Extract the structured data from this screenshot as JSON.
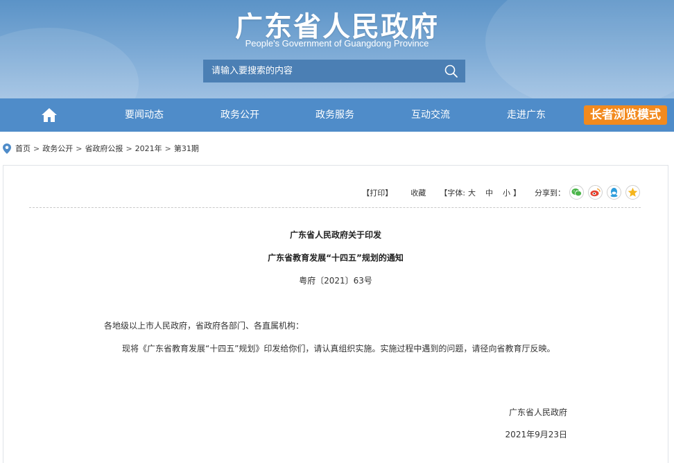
{
  "header": {
    "title": "广东省人民政府",
    "subtitle": "People's Government of Guangdong Province",
    "search_placeholder": "请输入要搜索的内容",
    "search_icon": "search-icon"
  },
  "nav": {
    "home_icon": "home-icon",
    "items": [
      "要闻动态",
      "政务公开",
      "政务服务",
      "互动交流",
      "走进广东"
    ],
    "elder_mode": "长者浏览模式"
  },
  "breadcrumb": {
    "icon": "location-pin-icon",
    "items": [
      "首页",
      "政务公开",
      "省政府公报",
      "2021年",
      "第31期"
    ],
    "separator": ">"
  },
  "toolbar": {
    "print": "【打印】",
    "favorite": "收藏",
    "font_label": "【字体:",
    "font_large": "大",
    "font_medium": "中",
    "font_small": "小",
    "font_end": "】",
    "share_label": "分享到：",
    "share_icons": [
      "wechat-icon",
      "weibo-icon",
      "qq-icon",
      "qzone-icon"
    ]
  },
  "document": {
    "title_line1": "广东省人民政府关于印发",
    "title_line2": "广东省教育发展“十四五”规划的通知",
    "doc_number": "粤府〔2021〕63号",
    "salutation": "各地级以上市人民政府，省政府各部门、各直属机构：",
    "body": "现将《广东省教育发展“十四五”规划》印发给你们，请认真组织实施。实施过程中遇到的问题，请径向省教育厅反映。",
    "signature": "广东省人民政府",
    "date": "2021年9月23日"
  },
  "colors": {
    "nav_bg": "#4f8cc9",
    "elder_btn": "#f28a1e",
    "search_bg": "#4b7fb4"
  }
}
